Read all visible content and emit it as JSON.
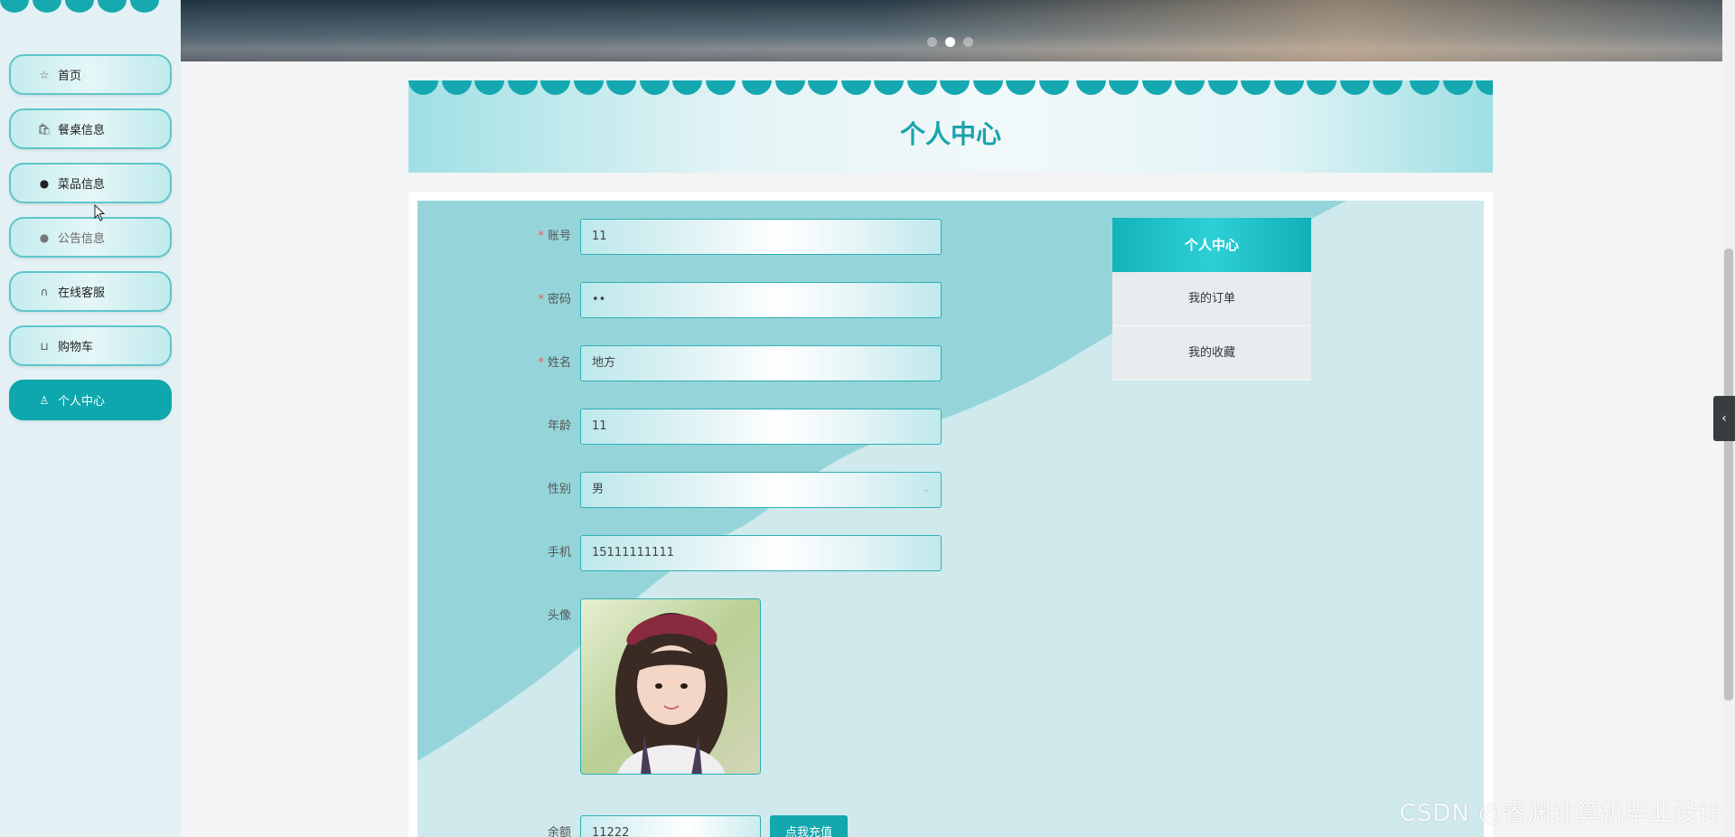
{
  "sidebar": {
    "items": [
      {
        "label": "首页",
        "icon": "star-icon"
      },
      {
        "label": "餐桌信息",
        "icon": "bag-icon"
      },
      {
        "label": "菜品信息",
        "icon": "info-circle-icon"
      },
      {
        "label": "公告信息",
        "icon": "question-circle-icon"
      },
      {
        "label": "在线客服",
        "icon": "headset-icon"
      },
      {
        "label": "购物车",
        "icon": "cart-icon"
      },
      {
        "label": "个人中心",
        "icon": "user-icon"
      }
    ],
    "active": "个人中心"
  },
  "banner": {
    "slide_count": 3,
    "active_slide": 2
  },
  "page": {
    "title": "个人中心"
  },
  "form": {
    "account": {
      "label": "账号",
      "value": "11",
      "required": true
    },
    "password": {
      "label": "密码",
      "value": "••",
      "required": true
    },
    "name": {
      "label": "姓名",
      "value": "地方",
      "required": true
    },
    "age": {
      "label": "年龄",
      "value": "11"
    },
    "gender": {
      "label": "性别",
      "value": "男"
    },
    "phone": {
      "label": "手机",
      "value": "15111111111"
    },
    "avatar": {
      "label": "头像"
    },
    "balance": {
      "label": "余额",
      "value": "11222",
      "button": "点我充值"
    }
  },
  "side_menu": {
    "header": "个人中心",
    "items": [
      "我的订单",
      "我的收藏"
    ]
  },
  "watermark": "CSDN @睿渊计算机毕业设计",
  "colors": {
    "accent": "#14a7ae",
    "required": "#e85b5b",
    "panel_bg": "#cfe9ec"
  }
}
